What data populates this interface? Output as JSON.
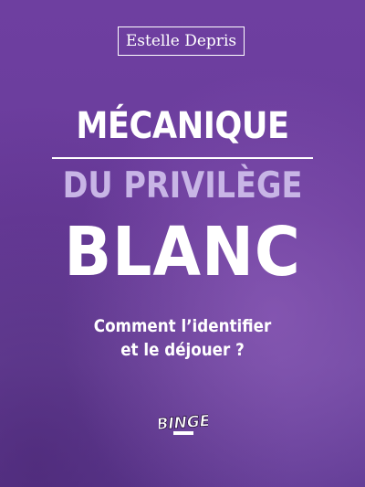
{
  "cover": {
    "author": "Estelle Depris",
    "title_line1": "MÉCANIQUE",
    "title_line2": "DU PRIVILÈGE",
    "title_line3": "BLANC",
    "subtitle_line1": "Comment l’identifier",
    "subtitle_line2": "et le déjouer ?",
    "publisher_logo": "BINGE",
    "colors": {
      "background": "#6a3c9c",
      "accent_lavender": "#c8b5e6",
      "text": "#ffffff"
    }
  }
}
